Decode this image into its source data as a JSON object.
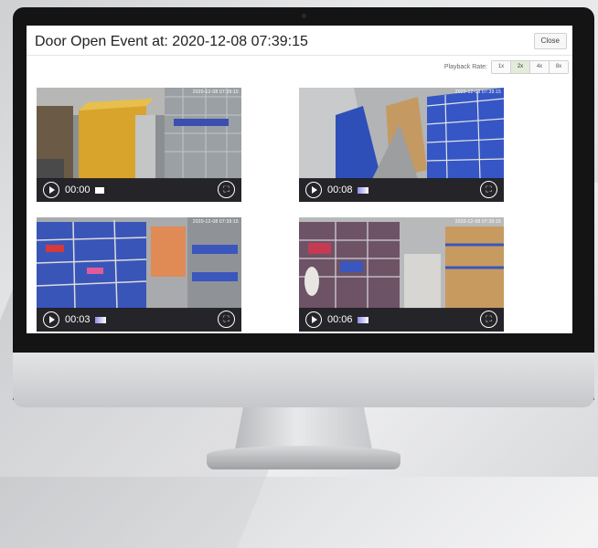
{
  "dialog": {
    "title": "Door Open Event at: 2020-12-08 07:39:15",
    "close_label": "Close"
  },
  "playback": {
    "label": "Playback Rate:",
    "rates": [
      "1x",
      "2x",
      "4x",
      "8x"
    ],
    "selected": "2x"
  },
  "videos": [
    {
      "time": "00:00",
      "progress": 0.04,
      "timestamp": "2020-12-08 07:39:15"
    },
    {
      "time": "00:08",
      "progress": 0.05,
      "timestamp": "2020-12-08 07:39:15"
    },
    {
      "time": "00:03",
      "progress": 0.05,
      "timestamp": "2020-12-08 07:39:15"
    },
    {
      "time": "00:06",
      "progress": 0.05,
      "timestamp": "2020-12-08 07:39:15"
    }
  ],
  "icons": {
    "play": "play-icon",
    "fullscreen": "fullscreen-icon"
  },
  "colors": {
    "active_rate": "#e3ecd9",
    "progress_accent": "#8f8ee8"
  }
}
